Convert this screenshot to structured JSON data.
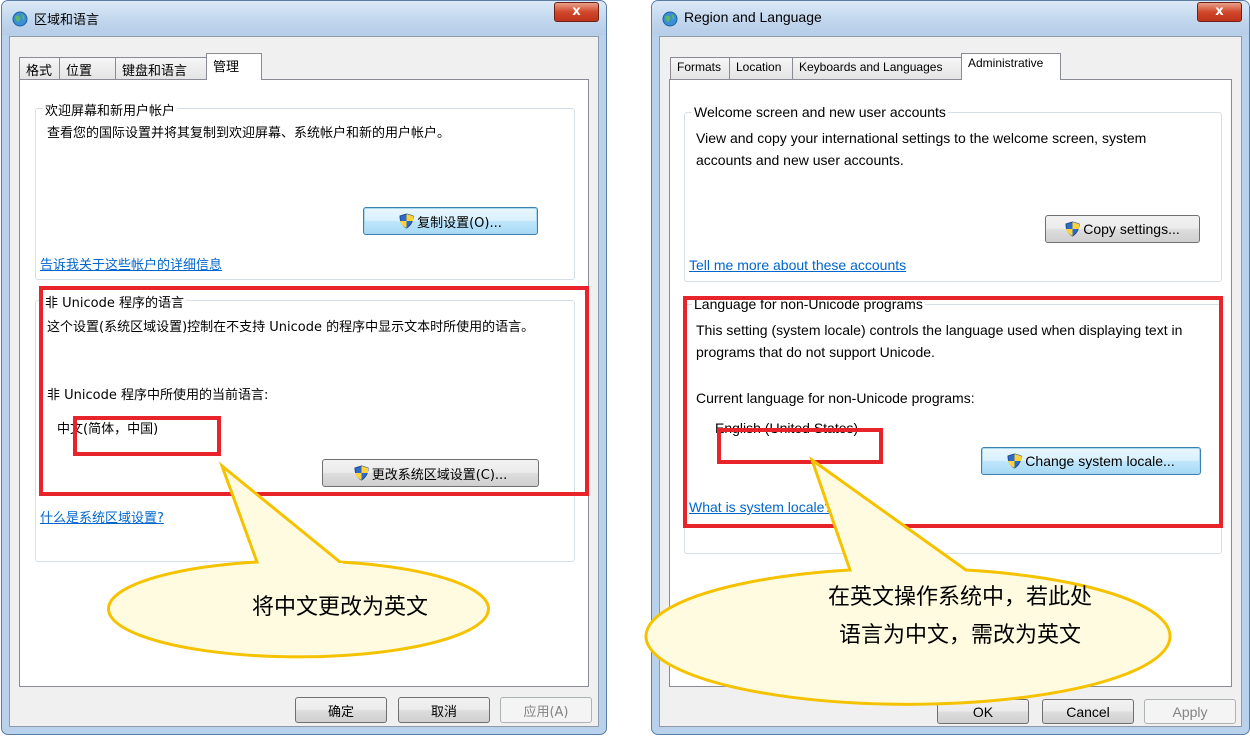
{
  "left_window": {
    "title": "区域和语言",
    "close_label": "x",
    "tabs": [
      "格式",
      "位置",
      "键盘和语言",
      "管理"
    ],
    "welcome_group": {
      "legend": "欢迎屏幕和新用户帐户",
      "description": "查看您的国际设置并将其复制到欢迎屏幕、系统帐户和新的用户帐户。",
      "copy_button": "复制设置(O)...",
      "link": "告诉我关于这些帐户的详细信息"
    },
    "locale_group": {
      "legend": "非 Unicode 程序的语言",
      "description": "这个设置(系统区域设置)控制在不支持 Unicode 的程序中显示文本时所使用的语言。",
      "current_label": "非 Unicode 程序中所使用的当前语言:",
      "current_value": "中文(简体，中国)",
      "change_button": "更改系统区域设置(C)...",
      "link": "什么是系统区域设置?"
    },
    "buttons": {
      "ok": "确定",
      "cancel": "取消",
      "apply": "应用(A)"
    },
    "annotation": "将中文更改为英文"
  },
  "right_window": {
    "title": "Region and Language",
    "close_label": "x",
    "tabs": [
      "Formats",
      "Location",
      "Keyboards and Languages",
      "Administrative"
    ],
    "welcome_group": {
      "legend": "Welcome screen and new user accounts",
      "description": "View and copy your international settings to the welcome screen, system accounts and new user accounts.",
      "copy_button": "Copy settings...",
      "link": "Tell me more about these accounts"
    },
    "locale_group": {
      "legend": "Language for non-Unicode programs",
      "description": "This setting (system locale) controls the language used when displaying text in programs that do not support Unicode.",
      "current_label": "Current language for non-Unicode programs:",
      "current_value": "English (United States)",
      "change_button": "Change system locale...",
      "link": "What is system locale?"
    },
    "buttons": {
      "ok": "OK",
      "cancel": "Cancel",
      "apply": "Apply"
    },
    "annotation_line1": "在英文操作系统中，若此处",
    "annotation_line2": "语言为中文，需改为英文"
  },
  "colors": {
    "annotation_red": "#e8232a",
    "callout_fill": "#fff8cc",
    "callout_stroke": "#f5c200",
    "link_blue": "#0066cc"
  },
  "icons": [
    "globe-icon",
    "shield-icon",
    "close-icon"
  ]
}
